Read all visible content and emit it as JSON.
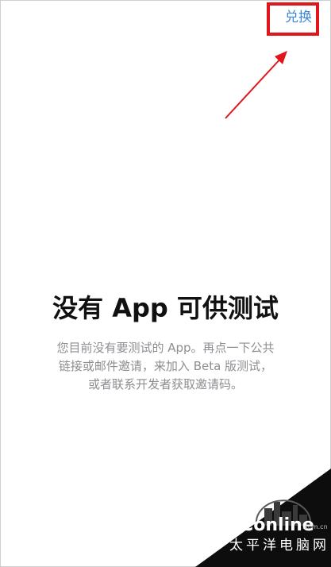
{
  "header": {
    "redeem_label": "兑换"
  },
  "empty_state": {
    "title": "没有 App 可供测试",
    "description_lines": [
      "您目前没有要测试的 App。再点一下公共",
      "链接或邮件邀请，来加入 Beta 版测试，",
      "或者联系开发者获取邀请码。"
    ]
  },
  "annotation": {
    "highlight_color": "#e0161c"
  },
  "watermark": {
    "brand": "PConline",
    "domain": ".com.cn",
    "caption": "太平洋电脑网"
  },
  "colors": {
    "link_blue": "#3b86d8",
    "secondary_text": "#8e8e93",
    "title_text": "#111111"
  }
}
